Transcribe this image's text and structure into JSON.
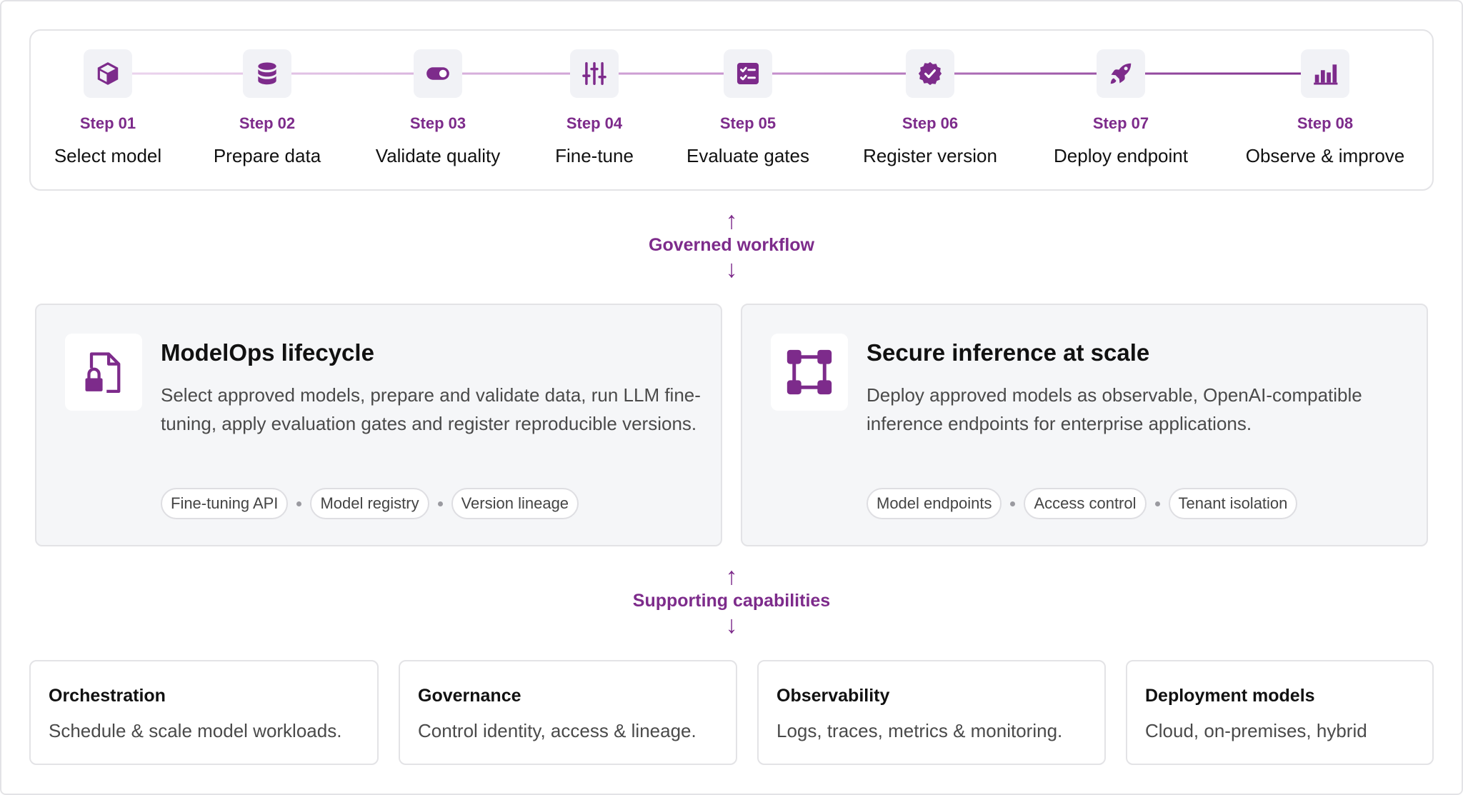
{
  "steps": [
    {
      "number": "Step 01",
      "label": "Select model",
      "icon": "cube-icon"
    },
    {
      "number": "Step 02",
      "label": "Prepare data",
      "icon": "database-icon"
    },
    {
      "number": "Step 03",
      "label": "Validate quality",
      "icon": "toggle-icon"
    },
    {
      "number": "Step 04",
      "label": "Fine-tune",
      "icon": "sliders-icon"
    },
    {
      "number": "Step 05",
      "label": "Evaluate gates",
      "icon": "checklist-icon"
    },
    {
      "number": "Step 06",
      "label": "Register version",
      "icon": "verified-badge-icon"
    },
    {
      "number": "Step 07",
      "label": "Deploy endpoint",
      "icon": "rocket-icon"
    },
    {
      "number": "Step 08",
      "label": "Observe & improve",
      "icon": "bar-chart-icon"
    }
  ],
  "flow_top": {
    "label": "Governed workflow",
    "up_arrow": "↑",
    "down_arrow": "↓"
  },
  "cards": [
    {
      "title": "ModelOps lifecycle",
      "description": "Select approved models, prepare and validate data, run LLM fine-tuning, apply evaluation gates and register reproducible versions.",
      "icon": "file-lock-icon",
      "chips": [
        "Fine-tuning API",
        "Model registry",
        "Version lineage"
      ]
    },
    {
      "title": "Secure inference at scale",
      "description": "Deploy approved models as observable, OpenAI-compatible inference endpoints for enterprise applications.",
      "icon": "nodes-square-icon",
      "chips": [
        "Model endpoints",
        "Access control",
        "Tenant isolation"
      ]
    }
  ],
  "flow_bottom": {
    "label": "Supporting capabilities",
    "up_arrow": "↑",
    "down_arrow": "↓"
  },
  "capabilities": [
    {
      "title": "Orchestration",
      "description": "Schedule & scale model workloads."
    },
    {
      "title": "Governance",
      "description": "Control identity, access & lineage."
    },
    {
      "title": "Observability",
      "description": "Logs, traces, metrics & monitoring."
    },
    {
      "title": "Deployment models",
      "description": "Cloud, on-premises, hybrid"
    }
  ],
  "colors": {
    "accent": "#7d2b8b",
    "line_light": "#e6cce8",
    "line_dark": "#7d2b8b",
    "tile_bg": "#f1f2f6",
    "card_bg": "#f5f6f8"
  }
}
